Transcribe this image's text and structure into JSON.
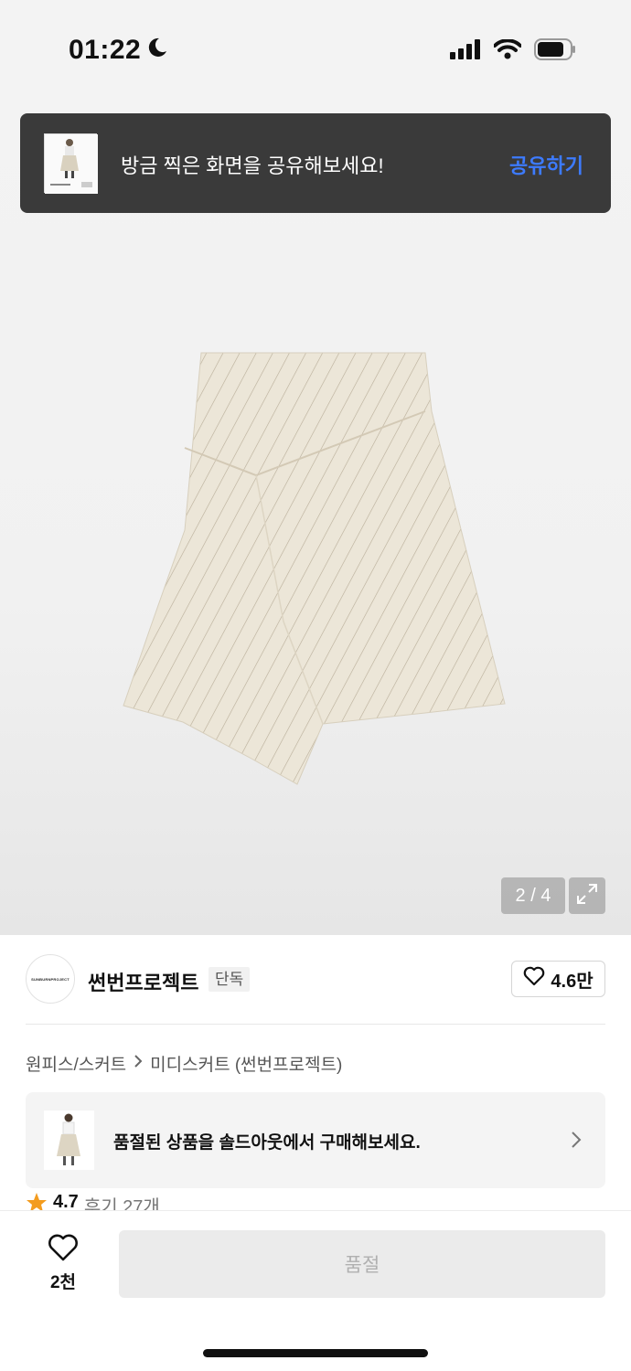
{
  "status": {
    "time": "01:22",
    "icons": [
      "moon-icon",
      "signal-icon",
      "wifi-icon",
      "battery-icon"
    ]
  },
  "toast": {
    "message": "방금 찍은 화면을 공유해보세요!",
    "action": "공유하기",
    "action_color": "#3d7bff"
  },
  "gallery": {
    "counter": "2 / 4"
  },
  "brand": {
    "logo_text": "SUNBURNPROJECT",
    "name": "썬번프로젝트",
    "badge": "단독",
    "likes": "4.6만"
  },
  "breadcrumb": {
    "category": "원피스/스커트",
    "subcategory": "미디스커트 (썬번프로젝트)"
  },
  "soldout_banner": {
    "text": "품절된 상품을 솔드아웃에서 구매해보세요."
  },
  "rating": {
    "score": "4.7",
    "reviews": "후기 27개",
    "star_color": "#f39c1f"
  },
  "bottom": {
    "wish_count": "2천",
    "buy_label": "품절"
  }
}
